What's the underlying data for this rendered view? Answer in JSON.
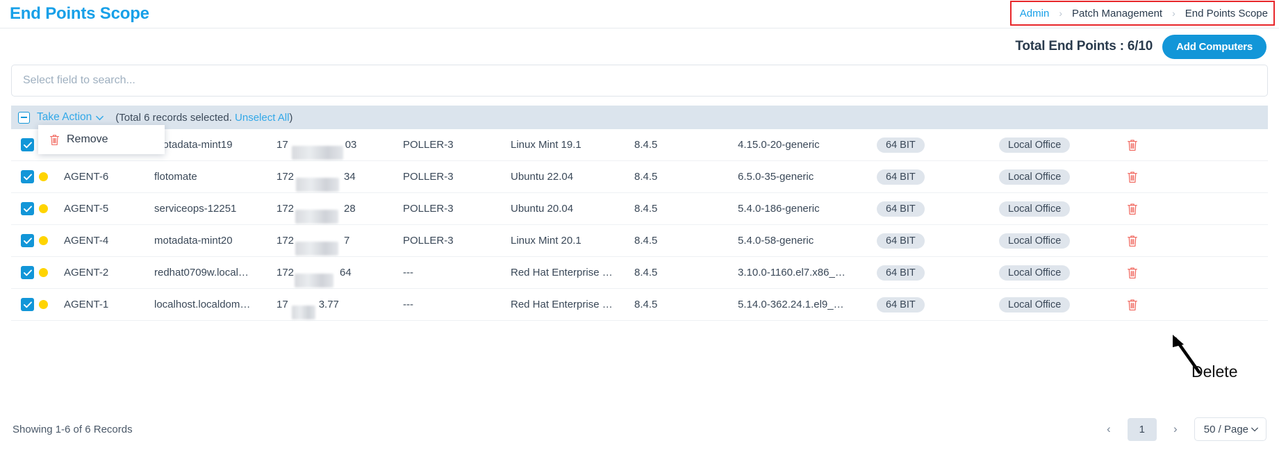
{
  "header": {
    "title": "End Points Scope",
    "breadcrumb": [
      {
        "label": "Admin",
        "link": true
      },
      {
        "label": "Patch Management",
        "link": false
      },
      {
        "label": "End Points Scope",
        "link": false
      }
    ],
    "breadcrumb_separator": "›",
    "highlight_color": "#e8262a"
  },
  "toolbar": {
    "total_label": "Total End Points : 6/10",
    "add_computers_label": "Add Computers",
    "accent_color": "#1296d8"
  },
  "search": {
    "placeholder": "Select field to search...",
    "value": ""
  },
  "actionbar": {
    "take_action_label": "Take Action",
    "selection_prefix": "(Total 6 records selected.",
    "unselect_all_label": "Unselect All",
    "selection_suffix": ")",
    "dropdown": {
      "open": true,
      "items": [
        {
          "label": "Remove",
          "icon": "trash-icon"
        }
      ]
    }
  },
  "table": {
    "rows": [
      {
        "selected": true,
        "status": "yellow",
        "agent": "",
        "host": "motadata-mint19",
        "ip_prefix": "17",
        "ip_suffix": "03",
        "ip_redacted": true,
        "poller": "POLLER-3",
        "os": "Linux Mint 19.1",
        "version": "8.4.5",
        "kernel": "4.15.0-20-generic",
        "arch": "64 BIT",
        "site": "Local Office",
        "delete_icon": "trash-icon"
      },
      {
        "selected": true,
        "status": "yellow",
        "agent": "AGENT-6",
        "host": "flotomate",
        "ip_prefix": "172",
        "ip_suffix": "34",
        "ip_redacted": true,
        "poller": "POLLER-3",
        "os": "Ubuntu 22.04",
        "version": "8.4.5",
        "kernel": "6.5.0-35-generic",
        "arch": "64 BIT",
        "site": "Local Office",
        "delete_icon": "trash-icon"
      },
      {
        "selected": true,
        "status": "yellow",
        "agent": "AGENT-5",
        "host": "serviceops-12251",
        "ip_prefix": "172",
        "ip_suffix": "28",
        "ip_redacted": true,
        "poller": "POLLER-3",
        "os": "Ubuntu 20.04",
        "version": "8.4.5",
        "kernel": "5.4.0-186-generic",
        "arch": "64 BIT",
        "site": "Local Office",
        "delete_icon": "trash-icon"
      },
      {
        "selected": true,
        "status": "yellow",
        "agent": "AGENT-4",
        "host": "motadata-mint20",
        "ip_prefix": "172",
        "ip_suffix": "7",
        "ip_redacted": true,
        "poller": "POLLER-3",
        "os": "Linux Mint 20.1",
        "version": "8.4.5",
        "kernel": "5.4.0-58-generic",
        "arch": "64 BIT",
        "site": "Local Office",
        "delete_icon": "trash-icon"
      },
      {
        "selected": true,
        "status": "yellow",
        "agent": "AGENT-2",
        "host": "redhat0709w.local…",
        "ip_prefix": "172",
        "ip_suffix": "64",
        "ip_redacted": true,
        "poller": "---",
        "os": "Red Hat Enterprise …",
        "version": "8.4.5",
        "kernel": "3.10.0-1160.el7.x86_…",
        "arch": "64 BIT",
        "site": "Local Office",
        "delete_icon": "trash-icon"
      },
      {
        "selected": true,
        "status": "yellow",
        "agent": "AGENT-1",
        "host": "localhost.localdom…",
        "ip_prefix": "17",
        "ip_suffix": "3.77",
        "ip_redacted": true,
        "poller": "---",
        "os": "Red Hat Enterprise …",
        "version": "8.4.5",
        "kernel": "5.14.0-362.24.1.el9_…",
        "arch": "64 BIT",
        "site": "Local Office",
        "delete_icon": "trash-icon"
      }
    ]
  },
  "annotation": {
    "label": "Delete"
  },
  "footer": {
    "showing": "Showing 1-6 of 6 Records",
    "prev_label": "‹",
    "page_number": "1",
    "next_label": "›",
    "page_size": "50 / Page"
  }
}
